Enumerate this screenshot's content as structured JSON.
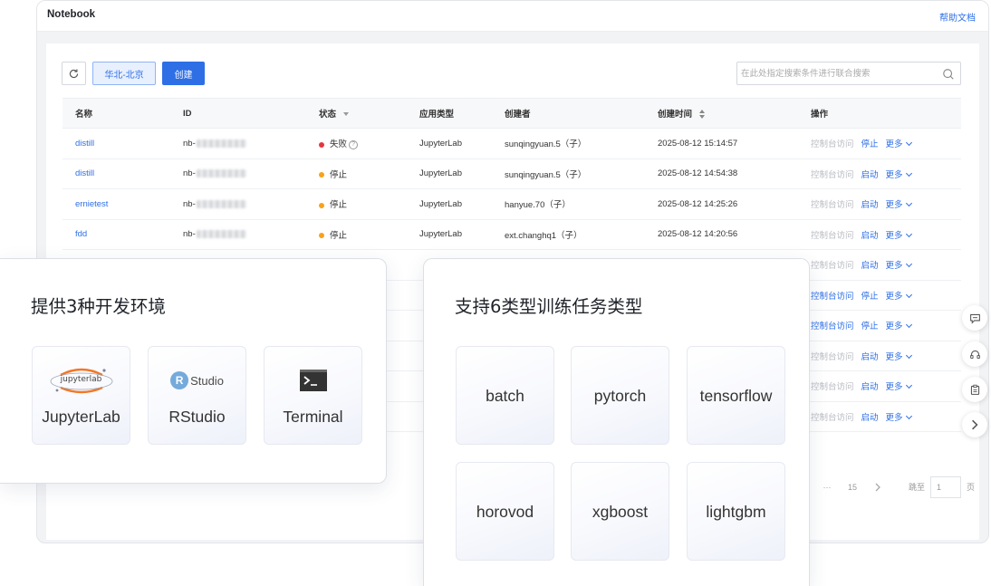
{
  "app": {
    "title": "Notebook",
    "help": "帮助文档"
  },
  "toolbar": {
    "region": "华北-北京",
    "create": "创建"
  },
  "search": {
    "placeholder": "在此处指定搜索条件进行联合搜索"
  },
  "table": {
    "headers": {
      "name": "名称",
      "id": "ID",
      "status": "状态",
      "app_type": "应用类型",
      "creator": "创建者",
      "created_at": "创建时间",
      "actions": "操作"
    },
    "rows": [
      {
        "name": "distill",
        "id_prefix": "nb-",
        "status": "失败",
        "status_color": "#e5363d",
        "app_type": "JupyterLab",
        "creator": "sunqingyuan.5（子）",
        "created_at": "2025-08-12 15:14:57",
        "console": "控制台访问",
        "toggle": "停止",
        "more": "更多"
      },
      {
        "name": "distill",
        "id_prefix": "nb-",
        "status": "停止",
        "status_color": "#f7a21b",
        "app_type": "JupyterLab",
        "creator": "sunqingyuan.5（子）",
        "created_at": "2025-08-12 14:54:38",
        "console": "控制台访问",
        "toggle": "启动",
        "more": "更多"
      },
      {
        "name": "ernietest",
        "id_prefix": "nb-",
        "status": "停止",
        "status_color": "#f7a21b",
        "app_type": "JupyterLab",
        "creator": "hanyue.70（子）",
        "created_at": "2025-08-12 14:25:26",
        "console": "控制台访问",
        "toggle": "启动",
        "more": "更多"
      },
      {
        "name": "fdd",
        "id_prefix": "nb-",
        "status": "停止",
        "status_color": "#f7a21b",
        "app_type": "JupyterLab",
        "creator": "ext.changhq1（子）",
        "created_at": "2025-08-12 14:20:56",
        "console": "控制台访问",
        "toggle": "启动",
        "more": "更多"
      }
    ],
    "partial_rows": [
      {
        "console": "控制台访问",
        "toggle": "启动",
        "more": "更多",
        "console_active": false
      },
      {
        "console": "控制台访问",
        "toggle": "停止",
        "more": "更多",
        "console_active": true
      },
      {
        "console": "控制台访问",
        "toggle": "停止",
        "more": "更多",
        "console_active": true
      },
      {
        "console": "控制台访问",
        "toggle": "启动",
        "more": "更多",
        "console_active": false
      },
      {
        "console": "控制台访问",
        "toggle": "启动",
        "more": "更多",
        "console_active": false
      },
      {
        "console": "控制台访问",
        "toggle": "启动",
        "more": "更多",
        "console_active": false
      }
    ]
  },
  "pagination": {
    "ellipsis": "···",
    "last_page": "15",
    "jump_label": "跳至",
    "jump_value": "1",
    "page_unit": "页"
  },
  "floating_icons": [
    "message-icon",
    "headset-icon",
    "clipboard-icon",
    "chevron-right-icon"
  ],
  "left_card": {
    "title": "提供3种开发环境",
    "items": [
      {
        "label": "JupyterLab",
        "logo_text": "jupyterlab",
        "icon": "jupyterlab-logo"
      },
      {
        "label": "RStudio",
        "logo_text": "Studio",
        "logo_letter": "R",
        "icon": "rstudio-logo"
      },
      {
        "label": "Terminal",
        "icon": "terminal-icon"
      }
    ]
  },
  "right_card": {
    "title": "支持6类型训练任务类型",
    "items": [
      "batch",
      "pytorch",
      "tensorflow",
      "horovod",
      "xgboost",
      "lightgbm"
    ]
  },
  "colors": {
    "primary": "#2e6fe6",
    "failed": "#e5363d",
    "stopped": "#f7a21b",
    "jupyter_orange": "#f37726",
    "rstudio_blue": "#75aadb"
  }
}
